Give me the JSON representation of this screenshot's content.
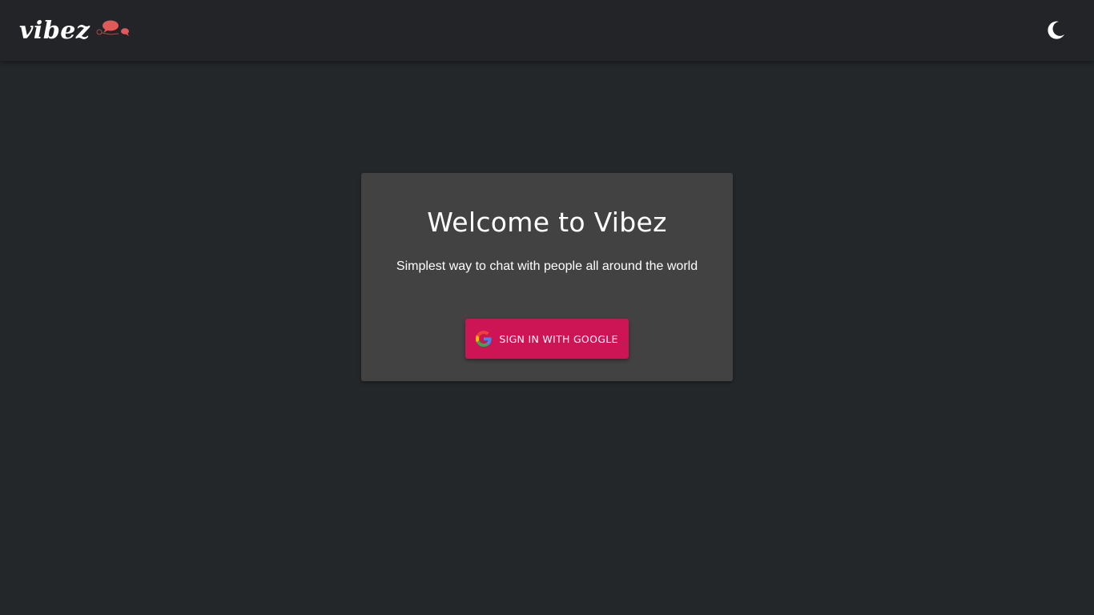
{
  "header": {
    "logo_text": "vibez",
    "logo_icon": "chat-bubbles-icon",
    "theme_toggle_icon": "moon-icon"
  },
  "card": {
    "title": "Welcome to Vibez",
    "subtitle": "Simplest way to chat with people all around the world",
    "signin_label": "SIGN IN WITH GOOGLE",
    "signin_icon": "google-icon"
  },
  "colors": {
    "background": "#24272a",
    "header": "#222427",
    "card": "#424242",
    "accent": "#cd1454",
    "logo_bubbles": "#e05a5a"
  }
}
